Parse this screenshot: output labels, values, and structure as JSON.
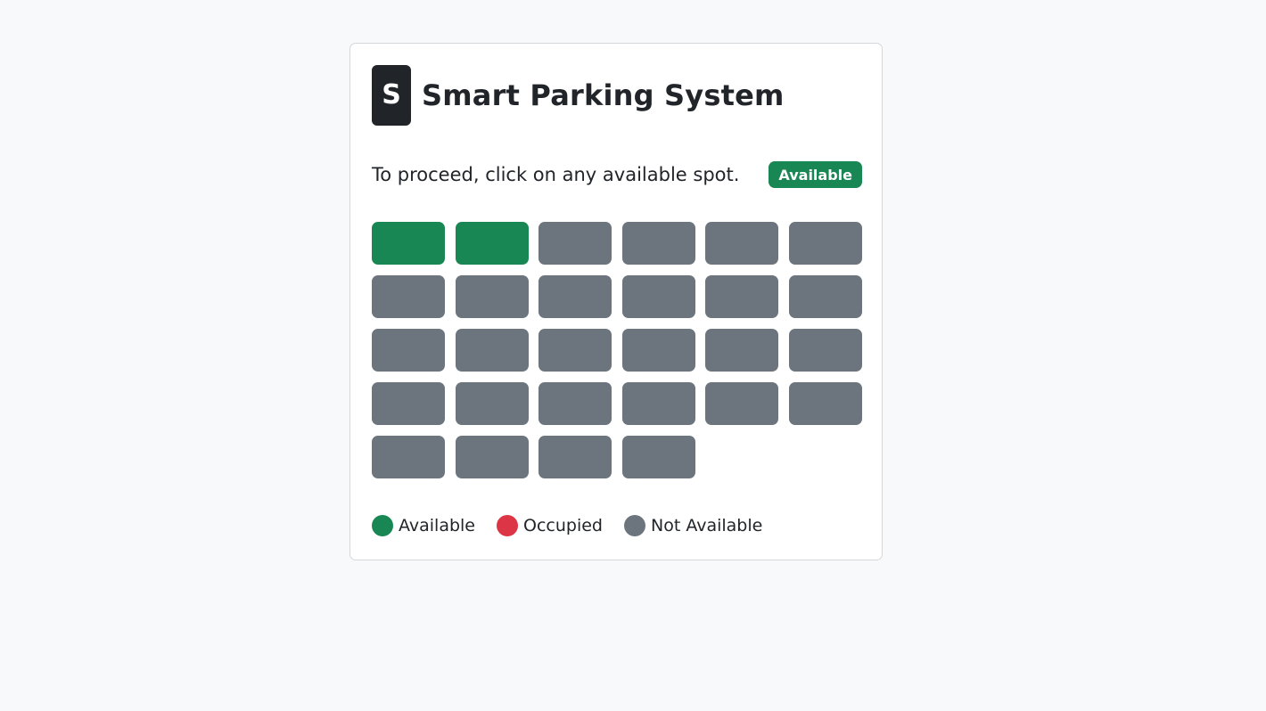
{
  "app": {
    "logo_letter": "S",
    "title": "Smart Parking System"
  },
  "instruction": {
    "text": "To proceed, click on any available spot.",
    "status_badge": "Available"
  },
  "spots": [
    {
      "status": "available"
    },
    {
      "status": "available"
    },
    {
      "status": "not-available"
    },
    {
      "status": "not-available"
    },
    {
      "status": "not-available"
    },
    {
      "status": "not-available"
    },
    {
      "status": "not-available"
    },
    {
      "status": "not-available"
    },
    {
      "status": "not-available"
    },
    {
      "status": "not-available"
    },
    {
      "status": "not-available"
    },
    {
      "status": "not-available"
    },
    {
      "status": "not-available"
    },
    {
      "status": "not-available"
    },
    {
      "status": "not-available"
    },
    {
      "status": "not-available"
    },
    {
      "status": "not-available"
    },
    {
      "status": "not-available"
    },
    {
      "status": "not-available"
    },
    {
      "status": "not-available"
    },
    {
      "status": "not-available"
    },
    {
      "status": "not-available"
    },
    {
      "status": "not-available"
    },
    {
      "status": "not-available"
    },
    {
      "status": "not-available"
    },
    {
      "status": "not-available"
    },
    {
      "status": "not-available"
    },
    {
      "status": "not-available"
    }
  ],
  "legend": [
    {
      "label": "Available",
      "color": "#198754",
      "icon": "green-dot-icon"
    },
    {
      "label": "Occupied",
      "color": "#dc3545",
      "icon": "red-dot-icon"
    },
    {
      "label": "Not Available",
      "color": "#6c757d",
      "icon": "gray-dot-icon"
    }
  ],
  "colors": {
    "available": "#198754",
    "occupied": "#dc3545",
    "not_available": "#6c757d",
    "background": "#f8f9fa"
  }
}
